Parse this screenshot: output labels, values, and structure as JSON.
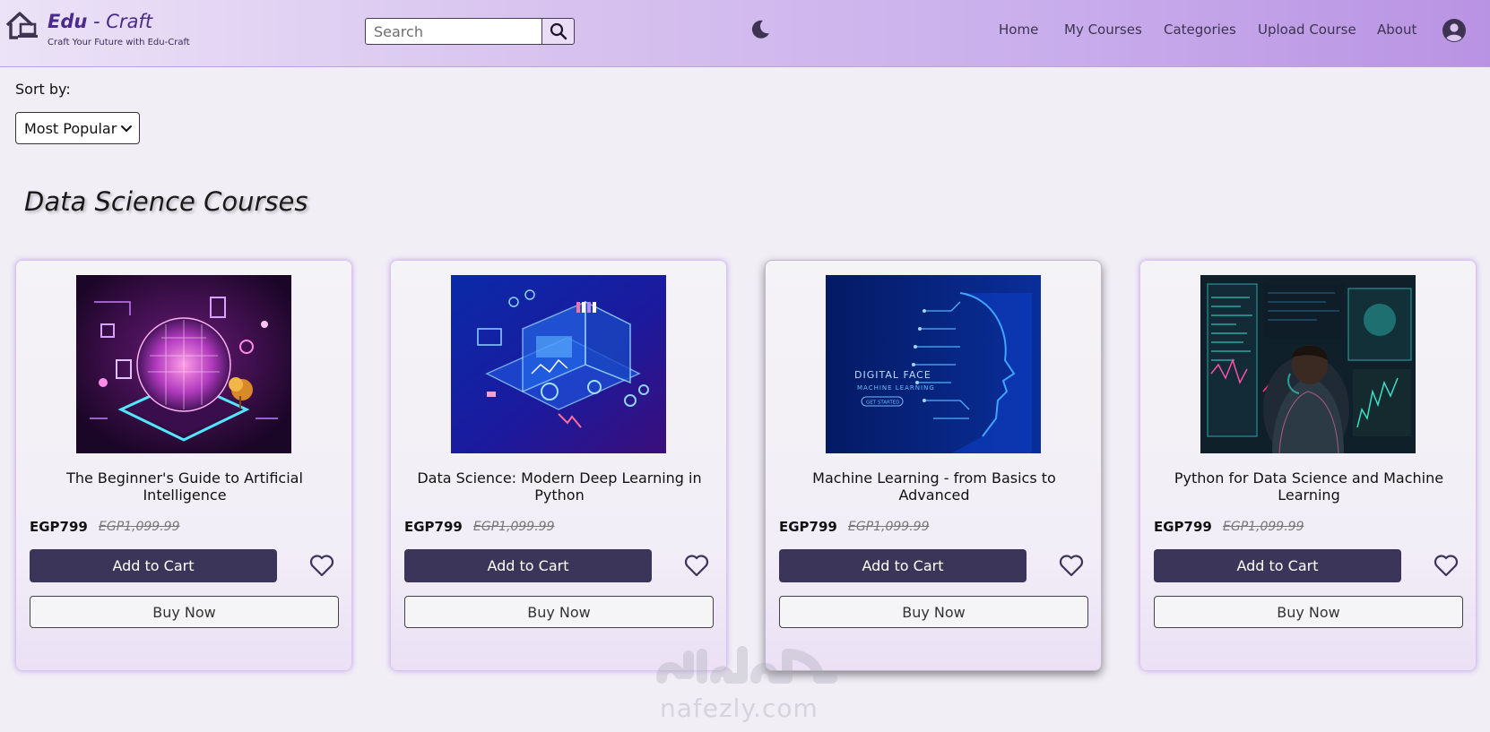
{
  "header": {
    "brand_main": "Edu",
    "brand_dash": " - ",
    "brand_sub": "Craft",
    "tagline": "Craft Your Future with Edu-Craft",
    "search_placeholder": "Search",
    "nav": [
      "Home",
      "My Courses",
      "Categories",
      "Upload Course",
      "About"
    ]
  },
  "sort": {
    "label": "Sort by:",
    "selected": "Most Popular"
  },
  "section_title": "Data Science Courses",
  "courses": [
    {
      "title": "The Beginner's Guide to Artificial Intelligence",
      "price": "EGP799",
      "old_price": "EGP1,099.99",
      "add_label": "Add to Cart",
      "buy_label": "Buy Now"
    },
    {
      "title": "Data Science: Modern Deep Learning in Python",
      "price": "EGP799",
      "old_price": "EGP1,099.99",
      "add_label": "Add to Cart",
      "buy_label": "Buy Now"
    },
    {
      "title": "Machine Learning - from Basics to Advanced",
      "price": "EGP799",
      "old_price": "EGP1,099.99",
      "add_label": "Add to Cart",
      "buy_label": "Buy Now",
      "image_text": [
        "DIGITAL FACE",
        "MACHINE LEARNING",
        "GET STARTED"
      ]
    },
    {
      "title": "Python for Data Science and Machine Learning",
      "price": "EGP799",
      "old_price": "EGP1,099.99",
      "add_label": "Add to Cart",
      "buy_label": "Buy Now"
    }
  ],
  "watermark": {
    "latin": "nafezly.com",
    "arabic": "نفذلي"
  },
  "colors": {
    "accent_dark": "#3b3659",
    "brand_purple": "#4a2a8a",
    "header_end": "#b993e3"
  }
}
